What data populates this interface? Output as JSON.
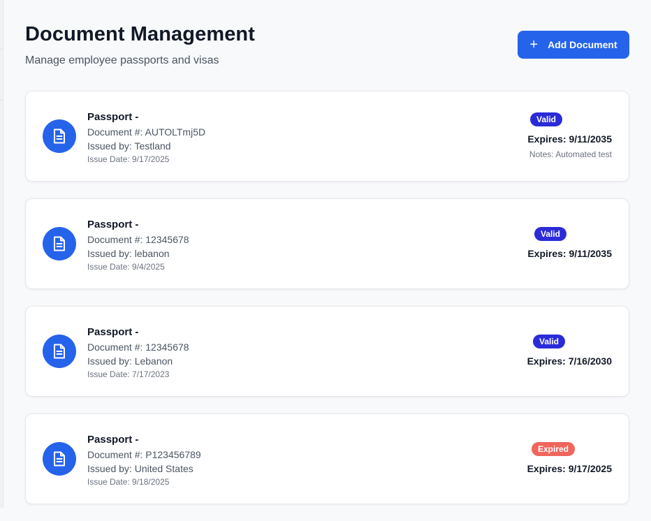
{
  "header": {
    "title": "Document Management",
    "subtitle": "Manage employee passports and visas",
    "add_button_label": "Add Document",
    "add_button_icon": "plus-icon"
  },
  "colors": {
    "accent": "#2563eb",
    "valid_badge": "#2b2bd9",
    "expired_badge": "#f0655c"
  },
  "documents": [
    {
      "type": "Passport -",
      "document_number": "Document #: AUTOLTmj5D",
      "issued_by": "Issued by: Testland",
      "issue_date": "Issue Date: 9/17/2025",
      "status": "Valid",
      "expires": "Expires: 9/11/2035",
      "notes": "Notes: Automated test"
    },
    {
      "type": "Passport -",
      "document_number": "Document #: 12345678",
      "issued_by": "Issued by: lebanon",
      "issue_date": "Issue Date: 9/4/2025",
      "status": "Valid",
      "expires": "Expires: 9/11/2035",
      "notes": ""
    },
    {
      "type": "Passport -",
      "document_number": "Document #: 12345678",
      "issued_by": "Issued by: Lebanon",
      "issue_date": "Issue Date: 7/17/2023",
      "status": "Valid",
      "expires": "Expires: 7/16/2030",
      "notes": ""
    },
    {
      "type": "Passport -",
      "document_number": "Document #: P123456789",
      "issued_by": "Issued by: United States",
      "issue_date": "Issue Date: 9/18/2025",
      "status": "Expired",
      "expires": "Expires: 9/17/2025",
      "notes": ""
    }
  ]
}
